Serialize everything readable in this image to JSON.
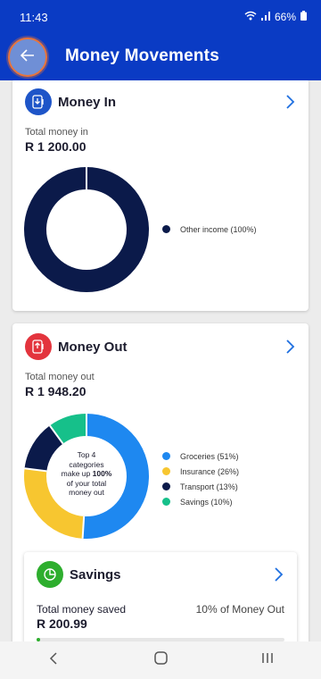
{
  "status_bar": {
    "time": "11:43",
    "battery": "66%"
  },
  "header": {
    "title": "Money Movements",
    "back_icon": "arrow-left-icon"
  },
  "money_in": {
    "title": "Money In",
    "total_label": "Total money in",
    "total_value": "R 1 200.00",
    "chart_data": {
      "type": "pie",
      "series": [
        {
          "label": "Other income (100%)",
          "value": 100,
          "color": "#0b1a4a"
        }
      ]
    }
  },
  "money_out": {
    "title": "Money Out",
    "total_label": "Total money out",
    "total_value": "R 1 948.20",
    "center_text": {
      "line1": "Top 4",
      "line2": "categories",
      "line3_prefix": "make up ",
      "line3_bold": "100%",
      "line4": "of your total",
      "line5": "money out"
    },
    "chart_data": {
      "type": "pie",
      "series": [
        {
          "label": "Groceries (51%)",
          "value": 51,
          "color": "#1e88f0"
        },
        {
          "label": "Insurance (26%)",
          "value": 26,
          "color": "#f7c630"
        },
        {
          "label": "Transport (13%)",
          "value": 13,
          "color": "#0b1a4a"
        },
        {
          "label": "Savings (10%)",
          "value": 10,
          "color": "#16c08a"
        }
      ]
    }
  },
  "savings": {
    "title": "Savings",
    "total_label": "Total money saved",
    "total_value": "R 200.99",
    "share_text": "10% of Money Out"
  },
  "colors": {
    "brand": "#0a3bc4",
    "chevron": "#1e6fe0"
  }
}
